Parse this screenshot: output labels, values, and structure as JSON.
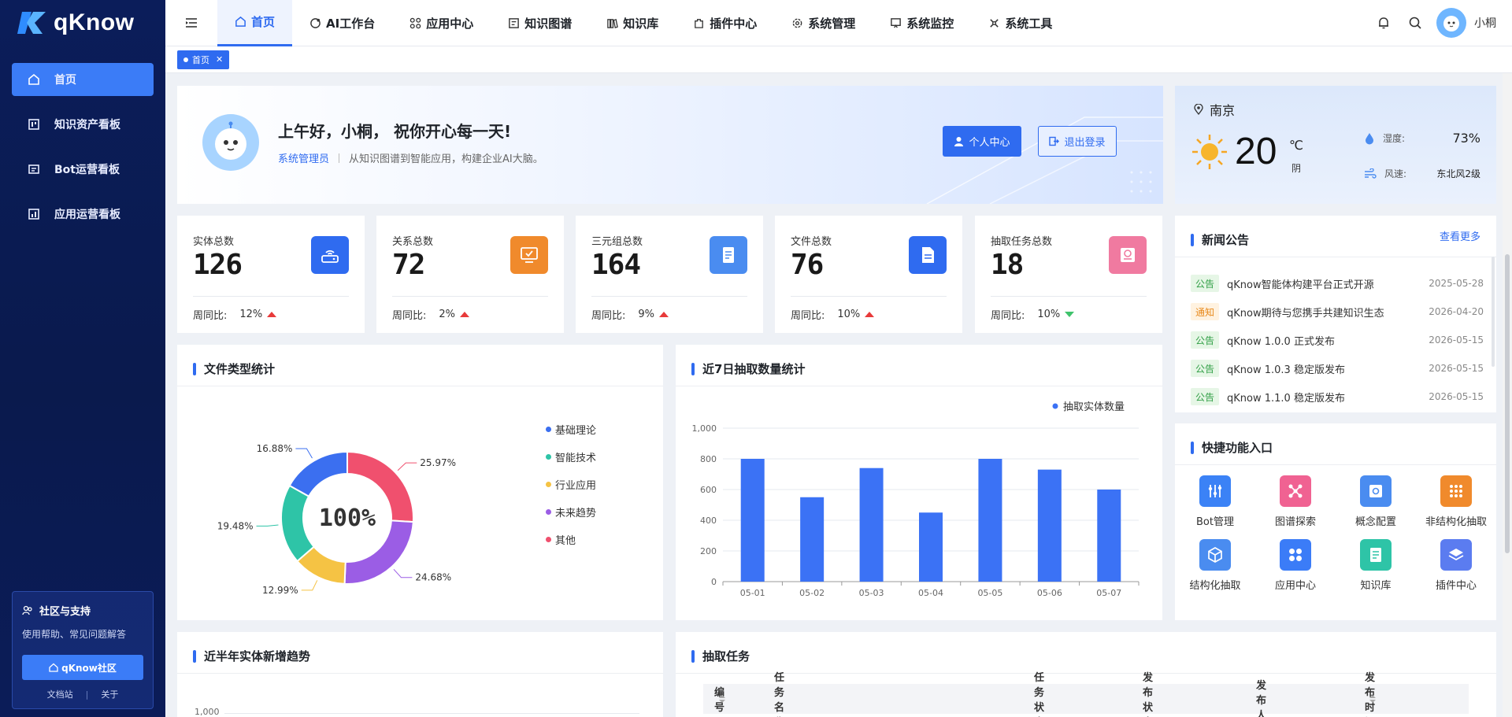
{
  "brand": {
    "name": "qKnow"
  },
  "sidebar": {
    "items": [
      {
        "label": "首页"
      },
      {
        "label": "知识资产看板"
      },
      {
        "label": "Bot运营看板"
      },
      {
        "label": "应用运营看板"
      }
    ],
    "support": {
      "title": "社区与支持",
      "desc": "使用帮助、常见问题解答",
      "button": "qKnow社区",
      "link_docs": "文档站",
      "link_about": "关于"
    }
  },
  "topnav": {
    "items": [
      {
        "label": "首页"
      },
      {
        "label": "AI工作台"
      },
      {
        "label": "应用中心"
      },
      {
        "label": "知识图谱"
      },
      {
        "label": "知识库"
      },
      {
        "label": "插件中心"
      },
      {
        "label": "系统管理"
      },
      {
        "label": "系统监控"
      },
      {
        "label": "系统工具"
      }
    ],
    "username": "小桐"
  },
  "tabs": {
    "home": "首页"
  },
  "welcome": {
    "greeting": "上午好，小桐， 祝你开心每一天!",
    "role": "系统管理员",
    "slogan": "从知识图谱到智能应用，构建企业AI大脑。",
    "btn_profile": "个人中心",
    "btn_logout": "退出登录"
  },
  "weather": {
    "city": "南京",
    "temp": "20",
    "unit": "℃",
    "condition": "阴",
    "humidity_label": "湿度:",
    "humidity": "73%",
    "wind_label": "风速:",
    "wind": "东北风2级"
  },
  "stats": [
    {
      "label": "实体总数",
      "value": "126",
      "week_label": "周同比:",
      "pct": "12%",
      "trend": "up",
      "color": "#2f6bf0",
      "icon": "router-icon"
    },
    {
      "label": "关系总数",
      "value": "72",
      "week_label": "周同比:",
      "pct": "2%",
      "trend": "up",
      "color": "#f08a2c",
      "icon": "monitor-icon"
    },
    {
      "label": "三元组总数",
      "value": "164",
      "week_label": "周同比:",
      "pct": "9%",
      "trend": "up",
      "color": "#4a8cf0",
      "icon": "document-icon"
    },
    {
      "label": "文件总数",
      "value": "76",
      "week_label": "周同比:",
      "pct": "10%",
      "trend": "up",
      "color": "#2f6bf0",
      "icon": "file-icon"
    },
    {
      "label": "抽取任务总数",
      "value": "18",
      "week_label": "周同比:",
      "pct": "10%",
      "trend": "down",
      "color": "#f07aa0",
      "icon": "task-icon"
    }
  ],
  "news": {
    "title": "新闻公告",
    "more": "查看更多",
    "items": [
      {
        "tag": "公告",
        "type": "g",
        "title": "qKnow智能体构建平台正式开源",
        "date": "2025-05-28"
      },
      {
        "tag": "通知",
        "type": "o",
        "title": "qKnow期待与您携手共建知识生态",
        "date": "2026-04-20"
      },
      {
        "tag": "公告",
        "type": "g",
        "title": "qKnow 1.0.0 正式发布",
        "date": "2026-05-15"
      },
      {
        "tag": "公告",
        "type": "g",
        "title": "qKnow 1.0.3 稳定版发布",
        "date": "2026-05-15"
      },
      {
        "tag": "公告",
        "type": "g",
        "title": "qKnow 1.1.0 稳定版发布",
        "date": "2026-05-15"
      }
    ]
  },
  "quick": {
    "title": "快捷功能入口",
    "items": [
      {
        "label": "Bot管理",
        "color": "#3b82f6",
        "icon": "sliders-icon"
      },
      {
        "label": "图谱探索",
        "color": "#f06292",
        "icon": "graph-icon"
      },
      {
        "label": "概念配置",
        "color": "#4a8cf0",
        "icon": "config-icon"
      },
      {
        "label": "非结构化抽取",
        "color": "#f08a2c",
        "icon": "grid-icon"
      },
      {
        "label": "结构化抽取",
        "color": "#4a8cf0",
        "icon": "cube-icon"
      },
      {
        "label": "应用中心",
        "color": "#3b7cf7",
        "icon": "apps-icon"
      },
      {
        "label": "知识库",
        "color": "#2ec4a7",
        "icon": "book-icon"
      },
      {
        "label": "插件中心",
        "color": "#5b7cf0",
        "icon": "layers-icon"
      }
    ]
  },
  "file_chart": {
    "title": "文件类型统计",
    "center": "100%"
  },
  "extract_chart": {
    "title": "近7日抽取数量统计"
  },
  "trend_chart": {
    "title": "近半年实体新增趋势",
    "ytick_top": "1,000"
  },
  "tasks": {
    "title": "抽取任务",
    "columns": [
      "编号",
      "任务名称",
      "任务状态",
      "发布状态",
      "发布人",
      "发布时间"
    ]
  },
  "chart_data": [
    {
      "type": "pie",
      "title": "文件类型统计",
      "categories": [
        "基础理论",
        "智能技术",
        "行业应用",
        "未来趋势",
        "其他"
      ],
      "values": [
        16.88,
        19.48,
        12.99,
        24.68,
        25.97
      ],
      "colors": [
        "#3b6ff0",
        "#2ec4a7",
        "#f5c344",
        "#9b5de5",
        "#f0506e"
      ],
      "labels": [
        "16.88%",
        "19.48%",
        "12.99%",
        "24.68%",
        "25.97%"
      ]
    },
    {
      "type": "bar",
      "title": "近7日抽取数量统计",
      "categories": [
        "05-01",
        "05-02",
        "05-03",
        "05-04",
        "05-05",
        "05-06",
        "05-07"
      ],
      "series": [
        {
          "name": "抽取实体数量",
          "values": [
            800,
            550,
            740,
            450,
            800,
            730,
            600
          ]
        }
      ],
      "ylim": [
        0,
        1000
      ],
      "yticks": [
        "0",
        "200",
        "400",
        "600",
        "800",
        "1,000"
      ],
      "legend": "top-right",
      "color": "#3b72f5"
    }
  ]
}
